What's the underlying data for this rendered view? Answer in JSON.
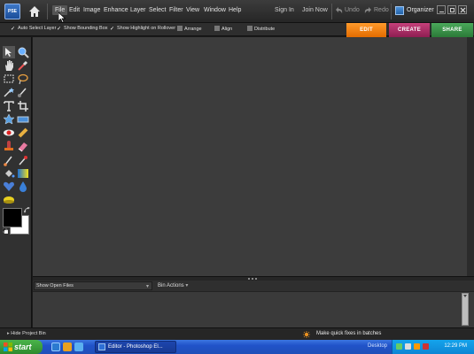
{
  "app": {
    "logo_text": "PSE"
  },
  "menu": {
    "items": [
      "File",
      "Edit",
      "Image",
      "Enhance",
      "Layer",
      "Select",
      "Filter",
      "View",
      "Window",
      "Help"
    ],
    "active": "File",
    "sign_in": "Sign In",
    "join_now": "Join Now",
    "undo": "Undo",
    "redo": "Redo",
    "organizer": "Organizer"
  },
  "options": {
    "auto_select_layer": "Auto Select Layer",
    "show_bounding_box": "Show Bounding Box",
    "show_highlight": "Show Highlight on Rollover",
    "arrange": "Arrange",
    "align": "Align",
    "distribute": "Distribute"
  },
  "mode_tabs": {
    "edit": "EDIT",
    "create": "CREATE",
    "share": "SHARE"
  },
  "colors": {
    "edit": "#f07d0d",
    "create": "#a8306a",
    "share": "#3c9a4b",
    "canvas": "#3c3c3c",
    "foreground": "#000000",
    "background": "#ffffff"
  },
  "project_bin": {
    "dropdown_value": "Show Open Files",
    "actions_label": "Bin Actions"
  },
  "status": {
    "hide_bin": "Hide Project Bin",
    "quick_fix": "Make quick fixes in batches"
  },
  "taskbar": {
    "start": "start",
    "task_label": "Editor - Photoshop El...",
    "desktop": "Desktop",
    "clock": "12:29 PM"
  }
}
